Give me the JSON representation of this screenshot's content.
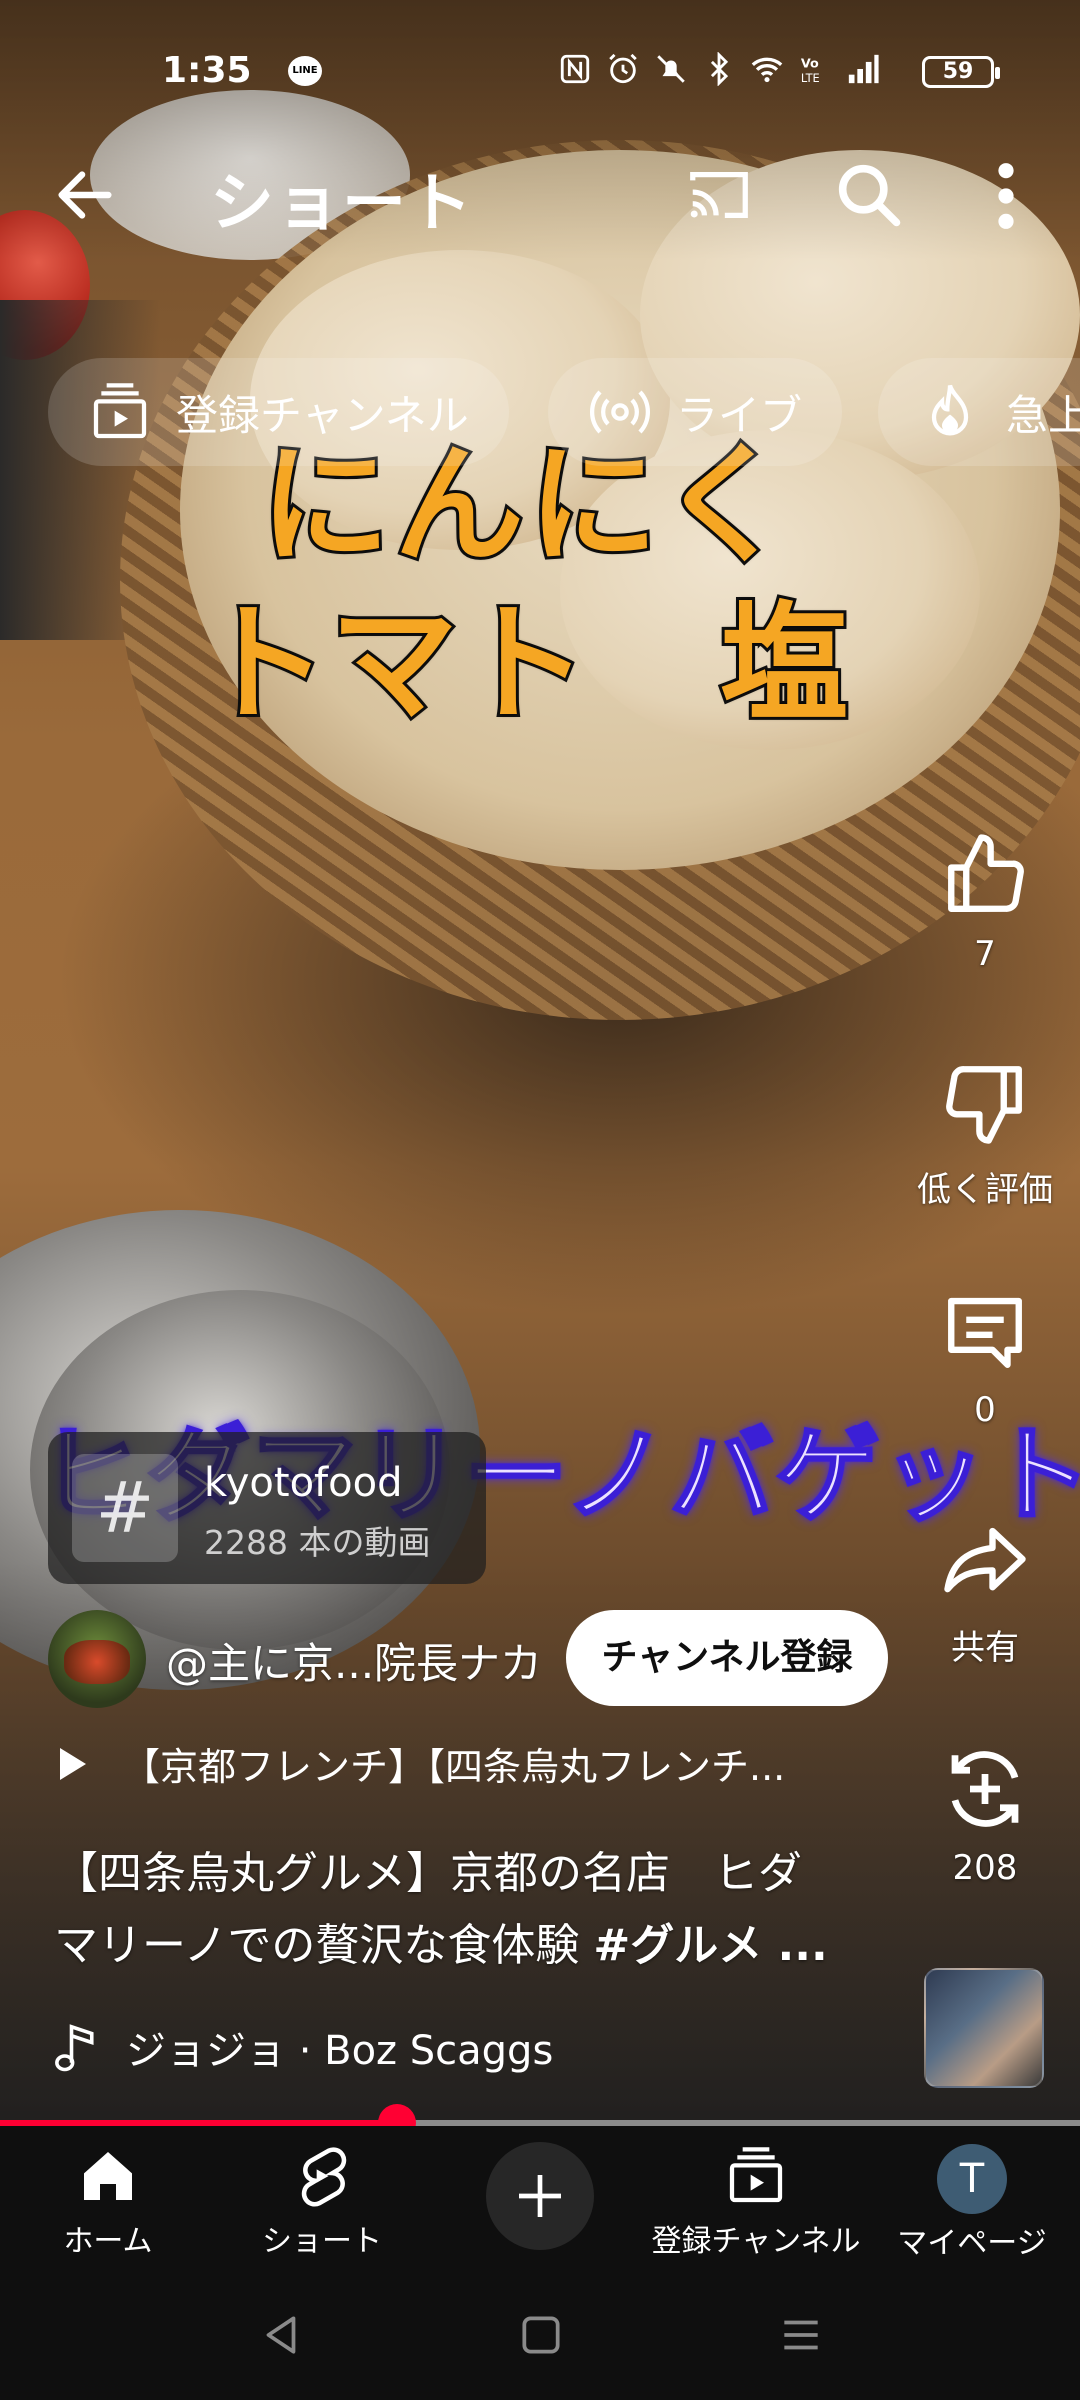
{
  "status_bar": {
    "time": "1:35",
    "line_badge": "LINE",
    "battery": "59"
  },
  "app_bar": {
    "title": "ショート"
  },
  "chips": [
    {
      "label": "登録チャンネル",
      "icon": "subscriptions-icon"
    },
    {
      "label": "ライブ",
      "icon": "live-icon"
    },
    {
      "label": "急上",
      "icon": "trending-icon"
    }
  ],
  "video_captions": {
    "line1": "にんにく",
    "line2": "トマト　塩",
    "line3": "ヒダマリーノバゲット"
  },
  "actions": {
    "like_count": "7",
    "dislike_label": "低く評価",
    "comment_count": "0",
    "share_label": "共有",
    "remix_count": "208"
  },
  "hashtag": {
    "symbol": "#",
    "name": "kyotofood",
    "count": "2288 本の動画"
  },
  "channel": {
    "name": "@主に京...院長ナカ",
    "subscribe_label": "チャンネル登録"
  },
  "related_video": "【京都フレンチ】【四条烏丸フレンチ...",
  "description": {
    "line1": "【四条烏丸グルメ】京都の名店　ヒダ",
    "line2_text": "マリーノでの贅沢な食体験 ",
    "line2_tag": "#グルメ ..."
  },
  "music": {
    "track": "ジョジョ · Boz Scaggs"
  },
  "progress": {
    "played_fraction": 0.368
  },
  "bottom_nav": {
    "home": "ホーム",
    "shorts": "ショート",
    "subscriptions": "登録チャンネル",
    "me": "マイページ",
    "me_initial": "T"
  },
  "colors": {
    "accent_red": "#ff0033",
    "caption_orange": "#f5a623",
    "caption_purple_glow": "#4f2bff"
  }
}
